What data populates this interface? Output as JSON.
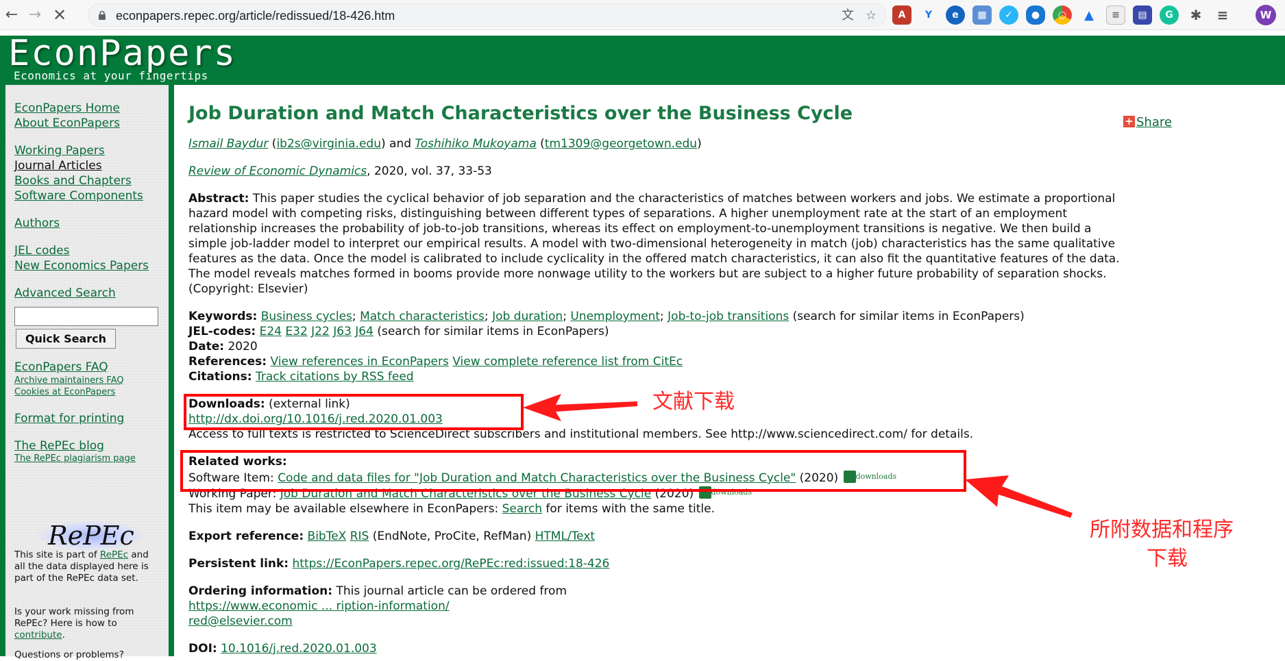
{
  "browser": {
    "url": "econpapers.repec.org/article/redissued/18-426.htm",
    "profile_initial": "W"
  },
  "site": {
    "title": "EconPapers",
    "tagline": "Economics at your fingertips"
  },
  "sidebar": {
    "home": "EconPapers Home",
    "about": "About EconPapers",
    "working_papers": "Working Papers",
    "journal_articles": "Journal Articles",
    "books": "Books and Chapters",
    "software": "Software Components",
    "authors": "Authors",
    "jel_codes": "JEL codes",
    "new_papers": "New Economics Papers",
    "advanced_search": "Advanced Search",
    "search_value": "",
    "quick_search": "Quick Search",
    "faq": "EconPapers FAQ",
    "archive_faq": "Archive maintainers FAQ",
    "cookies": "Cookies at EconPapers",
    "format_printing": "Format for printing",
    "repec_blog": "The RePEc blog",
    "plagiarism": "The RePEc plagiarism page",
    "logo_text": "RePEc",
    "note1_a": "This site is part of ",
    "note1_link": "RePEc",
    "note1_b": " and all the data displayed here is part of the RePEc data set.",
    "note2_a": "Is your work missing from RePEc? Here is how to ",
    "note2_link": "contribute",
    "note2_b": ".",
    "note3": "Questions or problems?"
  },
  "article": {
    "title": "Job Duration and Match Characteristics over the Business Cycle",
    "share": "Share",
    "author1": "Ismail Baydur",
    "email1": "ib2s@virginia.edu",
    "and": "and",
    "author2": "Toshihiko Mukoyama",
    "email2": "tm1309@georgetown.edu",
    "journal": "Review of Economic Dynamics",
    "journal_rest": ", 2020, vol. 37, 33-53",
    "abstract_label": "Abstract:",
    "abstract_text": "This paper studies the cyclical behavior of job separation and the characteristics of matches between workers and jobs. We estimate a proportional hazard model with competing risks, distinguishing between different types of separations. A higher unemployment rate at the start of an employment relationship increases the probability of job-to-job transitions, whereas its effect on employment-to-unemployment transitions is negative. We then build a simple job-ladder model to interpret our empirical results. A model with two-dimensional heterogeneity in match (job) characteristics has the same qualitative features as the data. Once the model is calibrated to include cyclicality in the offered match characteristics, it can also fit the quantitative features of the data. The model reveals matches formed in booms provide more nonwage utility to the workers but are subject to a higher future probability of separation shocks. (Copyright: Elsevier)",
    "keywords_label": "Keywords:",
    "keywords": [
      "Business cycles",
      "Match characteristics",
      "Job duration",
      "Unemployment",
      "Job-to-job transitions"
    ],
    "keywords_suffix": "(search for similar items in EconPapers)",
    "jel_label": "JEL-codes:",
    "jel": [
      "E24",
      "E32",
      "J22",
      "J63",
      "J64"
    ],
    "jel_suffix": "(search for similar items in EconPapers)",
    "date_label": "Date:",
    "date": "2020",
    "refs_label": "References:",
    "refs_link1": "View references in EconPapers",
    "refs_link2": "View complete reference list from CitEc",
    "citations_label": "Citations:",
    "citations_link": "Track citations by RSS feed",
    "downloads_label": "Downloads:",
    "downloads_note": "(external link)",
    "downloads_link": "http://dx.doi.org/10.1016/j.red.2020.01.003",
    "access_note": "Access to full texts is restricted to ScienceDirect subscribers and institutional members. See http://www.sciencedirect.com/ for details.",
    "related_label": "Related works:",
    "software_item_label": "Software Item:",
    "software_item_link": "Code and data files for \"Job Duration and Match Characteristics over the Business Cycle\"",
    "software_item_year": "(2020)",
    "working_paper_label": "Working Paper:",
    "working_paper_link": "Job Duration and Match Characteristics over the Business Cycle",
    "working_paper_year": "(2020)",
    "downloads_icon_text": "downloads",
    "elsewhere_a": "This item may be available elsewhere in EconPapers:",
    "elsewhere_link": "Search",
    "elsewhere_b": "for items with the same title.",
    "export_label": "Export reference:",
    "export_bibtex": "BibTeX",
    "export_ris": "RIS",
    "export_ris_note": "(EndNote, ProCite, RefMan)",
    "export_html": "HTML/Text",
    "persistent_label": "Persistent link:",
    "persistent_link": "https://EconPapers.repec.org/RePEc:red:issued:18-426",
    "ordering_label": "Ordering information:",
    "ordering_text": "This journal article can be ordered from",
    "ordering_link": "https://www.economic ... ription-information/",
    "ordering_email": "red@elsevier.com",
    "doi_label": "DOI:",
    "doi_link": "10.1016/j.red.2020.01.003"
  },
  "annotations": {
    "download_label": "文献下载",
    "data_label_line1": "所附数据和程序",
    "data_label_line2": "下载",
    "color": "#ff0000"
  }
}
